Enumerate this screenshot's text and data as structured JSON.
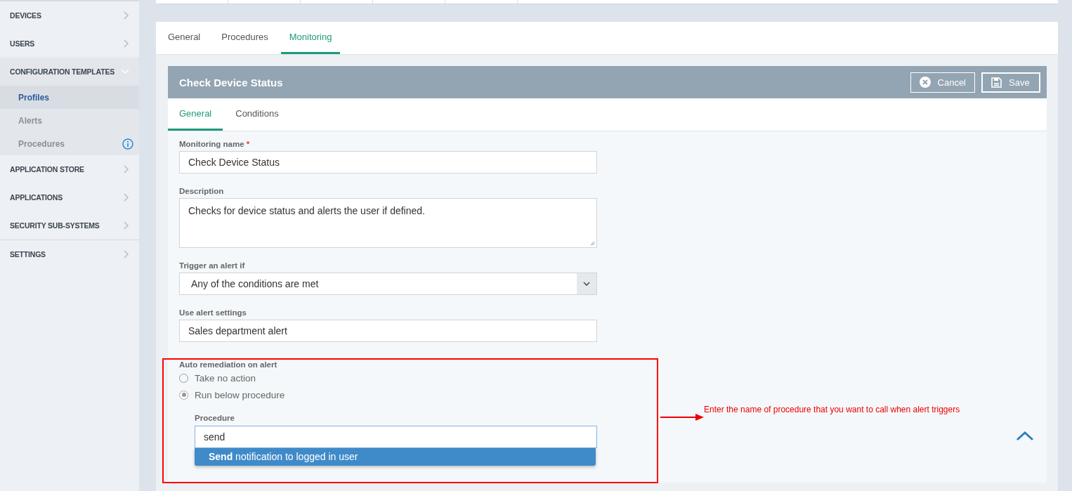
{
  "sidebar": {
    "items": [
      {
        "label": "DEVICES",
        "expanded": false
      },
      {
        "label": "USERS",
        "expanded": false
      },
      {
        "label": "CONFIGURATION TEMPLATES",
        "expanded": true,
        "children": [
          {
            "label": "Profiles",
            "selected": true,
            "info_icon": false
          },
          {
            "label": "Alerts",
            "selected": false,
            "info_icon": false
          },
          {
            "label": "Procedures",
            "selected": false,
            "info_icon": true
          }
        ]
      },
      {
        "label": "APPLICATION STORE",
        "expanded": false
      },
      {
        "label": "APPLICATIONS",
        "expanded": false
      },
      {
        "label": "SECURITY SUB-SYSTEMS",
        "expanded": false
      },
      {
        "label": "SETTINGS",
        "expanded": false
      }
    ]
  },
  "tabs": [
    {
      "label": "General",
      "selected": false
    },
    {
      "label": "Procedures",
      "selected": false
    },
    {
      "label": "Monitoring",
      "selected": true
    }
  ],
  "panel": {
    "title": "Check Device Status",
    "buttons": [
      {
        "kind": "cancel",
        "label": "Cancel"
      },
      {
        "kind": "save",
        "label": "Save"
      }
    ],
    "tabs": [
      {
        "label": "General",
        "selected": true
      },
      {
        "label": "Conditions",
        "selected": false
      }
    ],
    "form": {
      "monitoring_name": {
        "label": "Monitoring name",
        "required_mark": "*",
        "value": "Check Device Status"
      },
      "description": {
        "label": "Description",
        "value": "Checks for device status and alerts the user if defined."
      },
      "trigger": {
        "label": "Trigger an alert if",
        "value": "Any of the conditions are met"
      },
      "alert_settings": {
        "label": "Use alert settings",
        "value": "Sales department alert"
      },
      "remediation": {
        "label": "Auto remediation on alert",
        "options": [
          {
            "label": "Take no action",
            "selected": false
          },
          {
            "label": "Run below procedure",
            "selected": true
          }
        ]
      },
      "procedure": {
        "label": "Procedure",
        "value": "send",
        "suggestions": [
          "**Send** notification to logged in user"
        ]
      }
    }
  },
  "annotation": {
    "text": "Enter the name of procedure that you want to call when alert triggers"
  }
}
